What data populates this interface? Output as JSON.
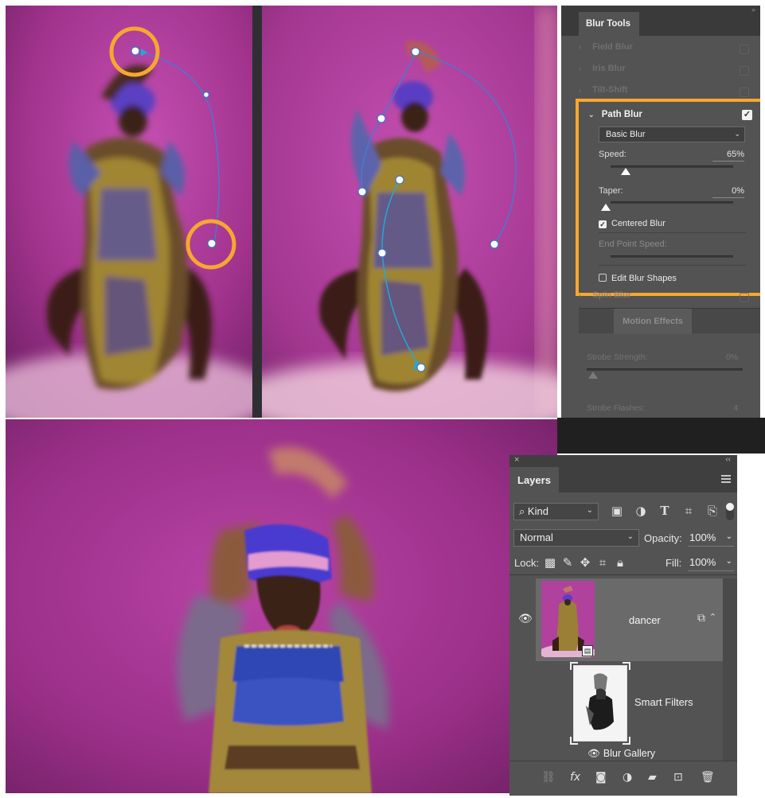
{
  "blur_tools": {
    "tab": "Blur Tools",
    "field_blur": "Field Blur",
    "iris_blur": "Iris Blur",
    "tilt_shift": "Tilt-Shift",
    "path_blur": {
      "title": "Path Blur",
      "checked": true,
      "mode": "Basic Blur",
      "speed_label": "Speed:",
      "speed_value": "65%",
      "taper_label": "Taper:",
      "taper_value": "0%",
      "centered_blur": "Centered Blur",
      "centered_checked": true,
      "end_point_speed": "End Point Speed:",
      "edit_blur_shapes": "Edit Blur Shapes",
      "edit_checked": false
    },
    "spin_blur": "Spin Blur",
    "motion_effects": "Motion Effects",
    "strobe_strength_label": "Strobe Strength:",
    "strobe_strength_value": "0%",
    "strobe_flashes_label": "Strobe Flashes:",
    "strobe_flashes_value": "4"
  },
  "layers": {
    "tab": "Layers",
    "kind_filter": "Kind",
    "blend_mode": "Normal",
    "opacity_label": "Opacity:",
    "opacity_value": "100%",
    "lock_label": "Lock:",
    "fill_label": "Fill:",
    "fill_value": "100%",
    "layer_name": "dancer",
    "smart_filters": "Smart Filters",
    "blur_gallery": "Blur Gallery"
  },
  "colors": {
    "highlight": "#f7a72e",
    "backdrop": "#b43c9c",
    "panel": "#535353"
  }
}
